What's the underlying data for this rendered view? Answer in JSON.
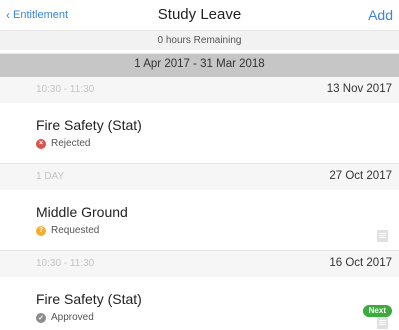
{
  "header": {
    "back_label": "Entitlement",
    "title": "Study Leave",
    "add_label": "Add",
    "subtitle": "0 hours Remaining"
  },
  "range": {
    "label": "1 Apr 2017 - 31 Mar 2018"
  },
  "entries": [
    {
      "time": "10:30 - 11:30",
      "date": "13 Nov 2017",
      "name": "Fire Safety (Stat)",
      "status": "Rejected",
      "status_icon": "rejected-icon",
      "status_color": "#d9534f",
      "stripe_color": "#d9c8b0",
      "note": false,
      "badge": ""
    },
    {
      "time": "1 DAY",
      "date": "27 Oct 2017",
      "name": "Middle Ground",
      "status": "Requested",
      "status_icon": "requested-icon",
      "status_color": "#f0ad2e",
      "stripe_color": "#a08a6c",
      "note": true,
      "badge": ""
    },
    {
      "time": "10:30 - 11:30",
      "date": "16 Oct 2017",
      "name": "Fire Safety (Stat)",
      "status": "Approved",
      "status_icon": "approved-icon",
      "status_color": "#8c8c8c",
      "stripe_color": "#8e7454",
      "note": true,
      "badge": "Next"
    }
  ],
  "colors": {
    "accent": "#3a86d4",
    "range_bar": "#c6c6c6"
  }
}
